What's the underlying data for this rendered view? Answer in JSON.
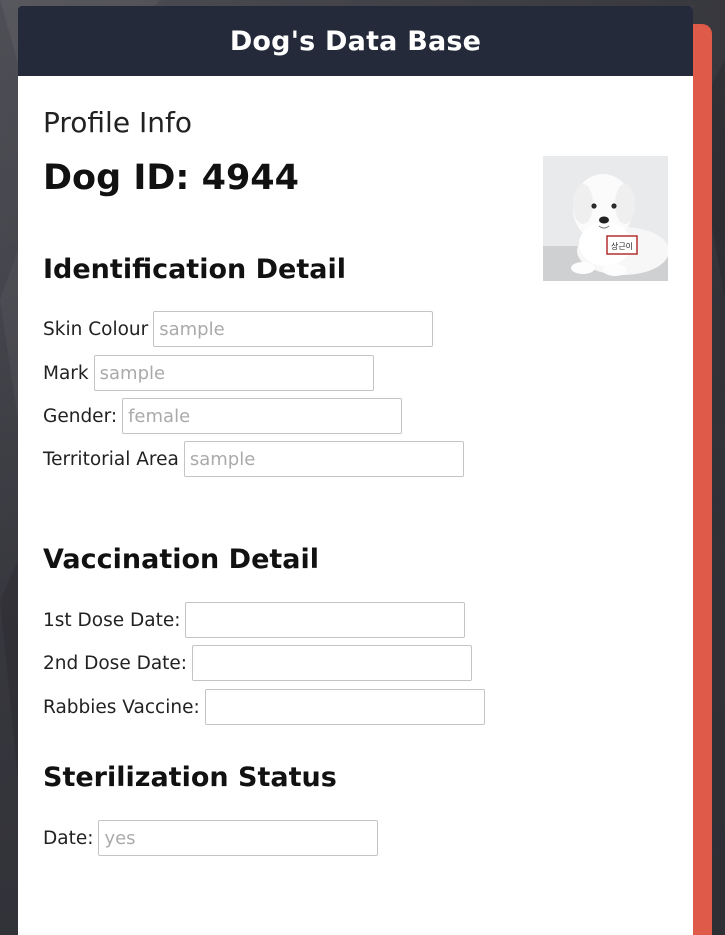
{
  "app": {
    "title": "Dog's Data Base"
  },
  "profile": {
    "heading": "Profile Info",
    "dog_id_text": "Dog ID: 4944",
    "photo_tag_text": "상근이"
  },
  "identification": {
    "title": "Identification Detail",
    "fields": [
      {
        "label": "Skin Colour",
        "placeholder": "sample",
        "value": ""
      },
      {
        "label": "Mark",
        "placeholder": "sample",
        "value": ""
      },
      {
        "label": "Gender:",
        "placeholder": "female",
        "value": ""
      },
      {
        "label": "Territorial Area",
        "placeholder": "sample",
        "value": ""
      }
    ]
  },
  "vaccination": {
    "title": "Vaccination Detail",
    "fields": [
      {
        "label": "1st Dose Date:",
        "placeholder": "",
        "value": ""
      },
      {
        "label": "2nd Dose Date:",
        "placeholder": "",
        "value": ""
      },
      {
        "label": "Rabbies Vaccine:",
        "placeholder": "",
        "value": ""
      }
    ]
  },
  "sterilization": {
    "title": "Sterilization Status",
    "fields": [
      {
        "label": "Date:",
        "placeholder": "yes",
        "value": ""
      }
    ]
  },
  "colors": {
    "header_bg": "#252a3b",
    "accent": "#e05a4a",
    "page_bg": "#3b3b42"
  }
}
